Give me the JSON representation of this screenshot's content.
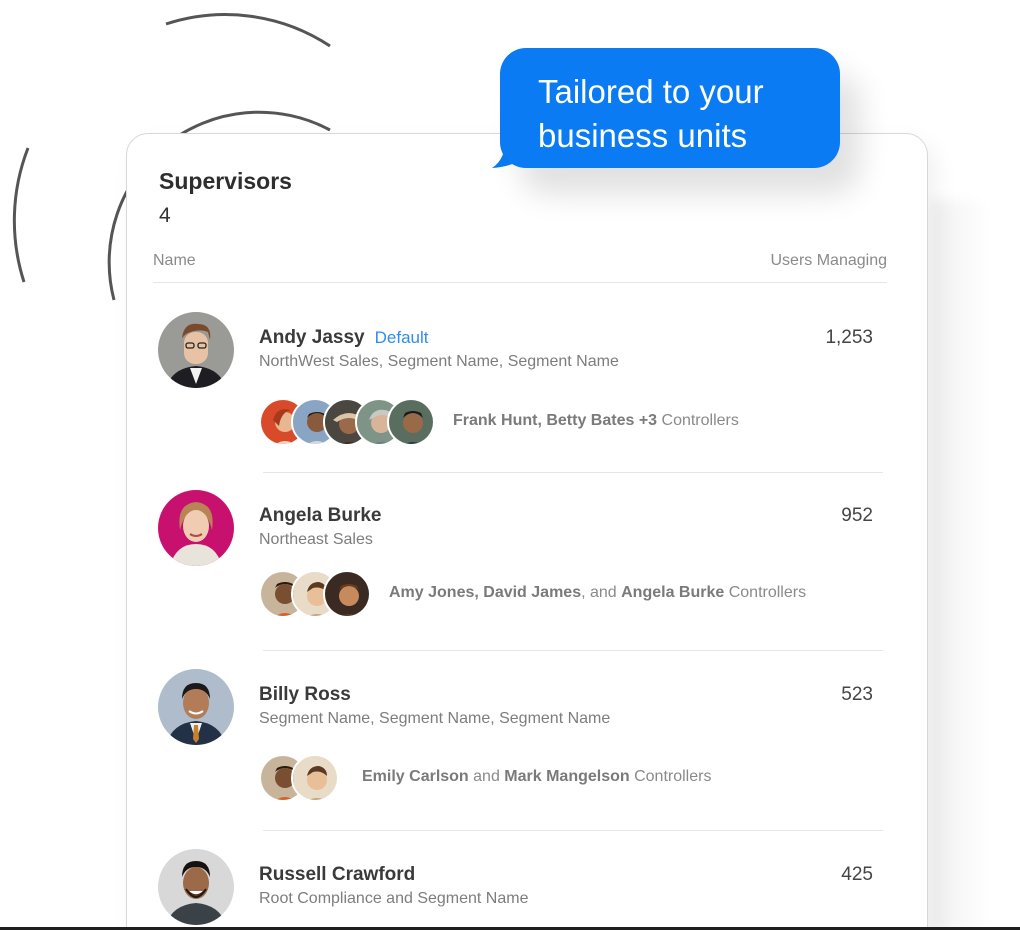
{
  "bubble": {
    "line1": "Tailored to your",
    "line2": "business units",
    "color": "#0a7bf2"
  },
  "card": {
    "title": "Supervisors",
    "count": "4",
    "columns": {
      "name": "Name",
      "users": "Users Managing"
    }
  },
  "supervisors": [
    {
      "name": "Andy Jassy",
      "tag": "Default",
      "segments": "NorthWest Sales, Segment Name, Segment Name",
      "users": "1,253",
      "controllers": {
        "bold1": "Frank Hunt, Betty Bates",
        "mid": " +3",
        "suffix": " Controllers"
      },
      "avatar_icon": "person-avatar-glasses-icon"
    },
    {
      "name": "Angela Burke",
      "segments": "Northeast Sales",
      "users": "952",
      "controllers": {
        "bold1": "Amy Jones, David James",
        "mid": ", and ",
        "bold2": "Angela Burke",
        "suffix": " Controllers"
      },
      "avatar_icon": "person-avatar-woman-icon"
    },
    {
      "name": "Billy Ross",
      "segments": "Segment Name, Segment Name, Segment Name",
      "users": "523",
      "controllers": {
        "bold1": "Emily Carlson",
        "mid": " and ",
        "bold2": "Mark Mangelson",
        "suffix": " Controllers"
      },
      "avatar_icon": "person-avatar-suit-icon"
    },
    {
      "name": "Russell Crawford",
      "segments": "Root Compliance and Segment Name",
      "users": "425",
      "avatar_icon": "person-avatar-smile-icon"
    }
  ]
}
